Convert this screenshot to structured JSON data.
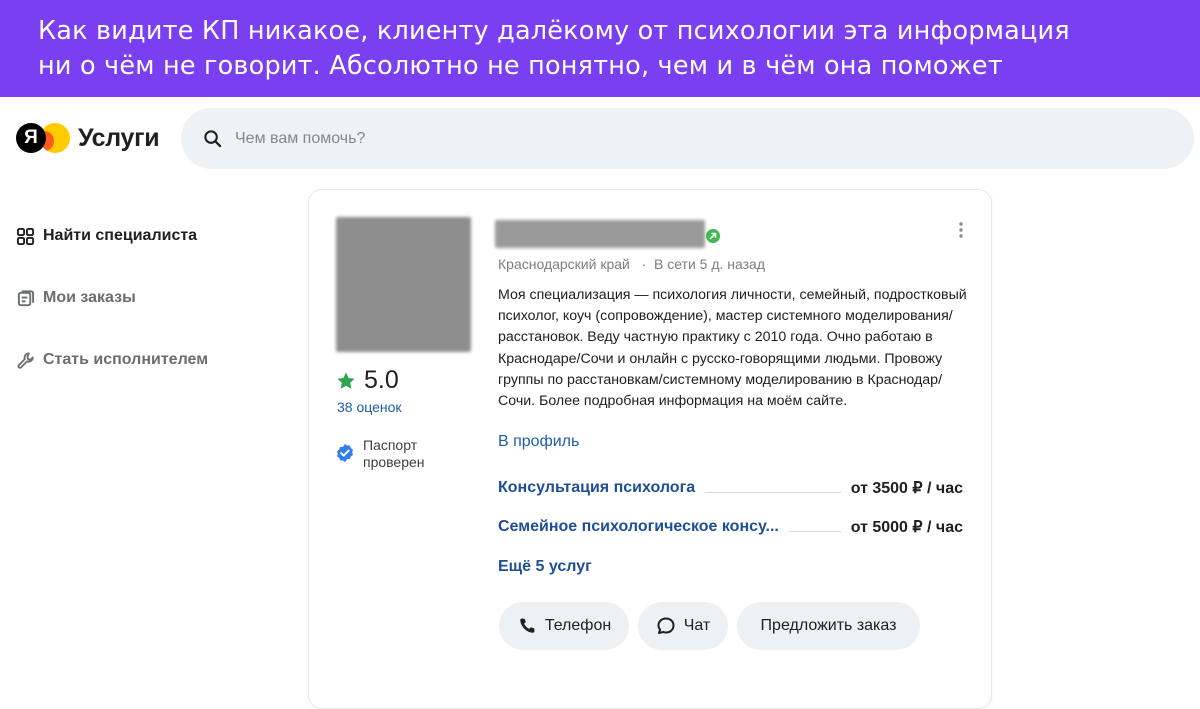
{
  "banner": {
    "line1": "Как видите КП никакое, клиенту далёкому от психологии эта информация",
    "line2": "ни о чём не говорит. Абсолютно не понятно, чем и в чём она поможет"
  },
  "logo": {
    "mark": "Я",
    "text": "Услуги"
  },
  "search": {
    "placeholder": "Чем вам помочь?"
  },
  "sidebar": {
    "items": [
      {
        "label": "Найти специалиста",
        "icon": "grid-icon"
      },
      {
        "label": "Мои заказы",
        "icon": "orders-icon"
      },
      {
        "label": "Стать исполнителем",
        "icon": "wrench-icon"
      }
    ]
  },
  "card": {
    "name": "",
    "location": "Краснодарский край",
    "online_status": "В сети 5 д. назад",
    "rating": "5.0",
    "reviews": "38 оценок",
    "passport": "Паспорт проверен",
    "about": "Моя специализация — психология личности, семейный, подростковый психолог, коуч (сопровождение), мастер системного моделирования/расстановок. Веду частную практику с 2010 года. Очно работаю в Краснодаре/Сочи и онлайн с русско-говорящими людьми. Провожу группы по расстановкам/системному моделированию в Краснодар/Сочи. Более подробная информация на моём сайте.",
    "profile_link": "В профиль",
    "services": [
      {
        "name": "Консультация психолога",
        "price": "от 3500 ₽ / час"
      },
      {
        "name": "Семейное психологическое консу...",
        "price": "от 5000 ₽ / час"
      }
    ],
    "more_services": "Ещё 5 услуг",
    "buttons": {
      "phone": "Телефон",
      "chat": "Чат",
      "order": "Предложить заказ"
    }
  },
  "colors": {
    "banner_bg": "#7b3ff2",
    "link": "#1f5ea8",
    "service_link": "#1f4f96",
    "rating_star": "#2ea44f",
    "verified": "#2f80ed",
    "online_dot": "#3fb950"
  }
}
